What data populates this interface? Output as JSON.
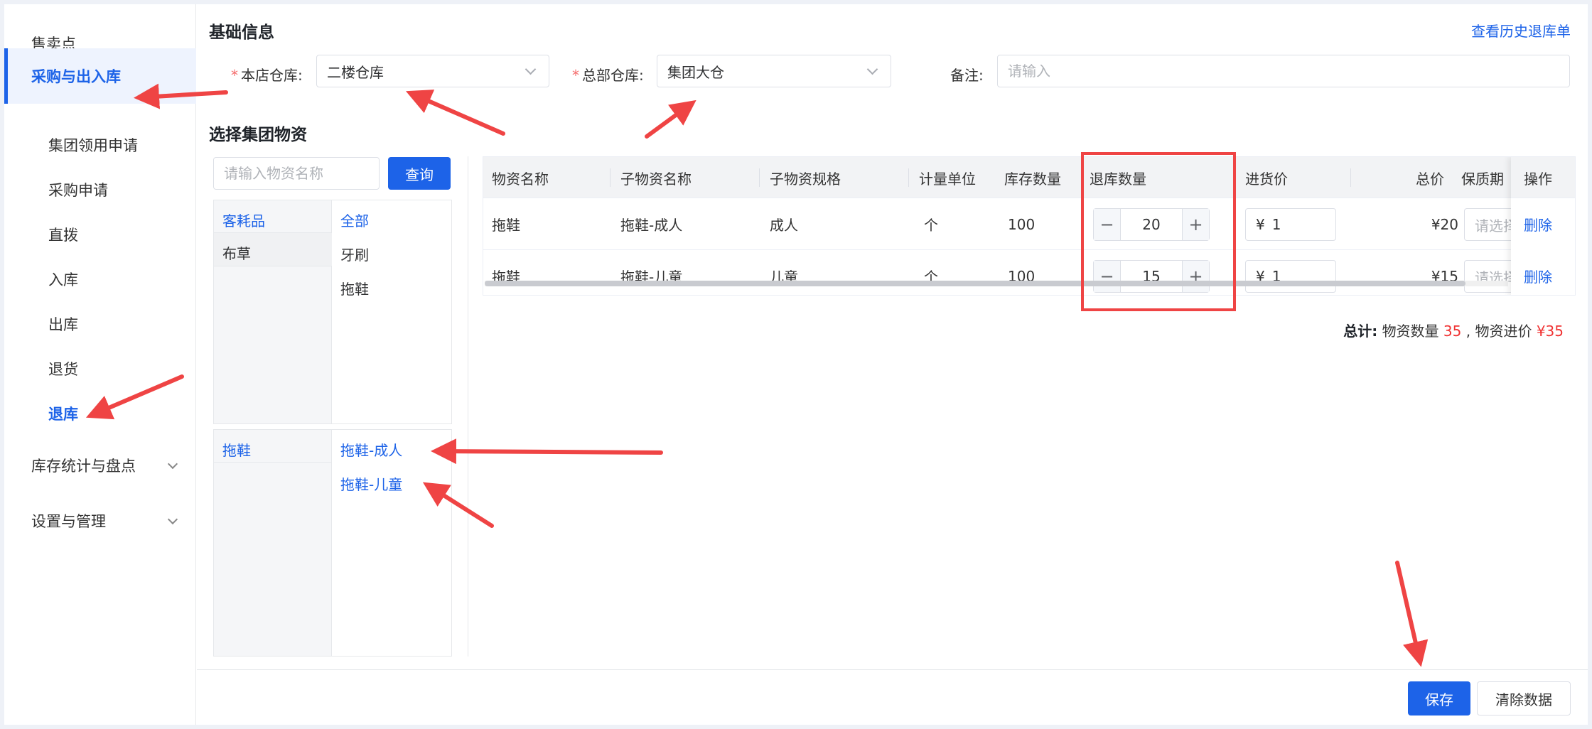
{
  "sidebar": {
    "items": [
      {
        "label": "售卖点"
      },
      {
        "label": "采购与出入库"
      },
      {
        "label": "集团领用申请"
      },
      {
        "label": "采购申请"
      },
      {
        "label": "直拨"
      },
      {
        "label": "入库"
      },
      {
        "label": "出库"
      },
      {
        "label": "退货"
      },
      {
        "label": "退库"
      },
      {
        "label": "库存统计与盘点"
      },
      {
        "label": "设置与管理"
      }
    ]
  },
  "basic": {
    "title": "基础信息",
    "history_link": "查看历史退库单",
    "store_wh_label": "本店仓库:",
    "store_wh_value": "二楼仓库",
    "hq_wh_label": "总部仓库:",
    "hq_wh_value": "集团大仓",
    "remark_label": "备注:",
    "remark_placeholder": "请输入"
  },
  "select_section": {
    "title": "选择集团物资",
    "search_placeholder": "请输入物资名称",
    "search_button": "查询",
    "categories_left": [
      "客耗品",
      "布草"
    ],
    "categories_right": [
      "全部",
      "牙刷",
      "拖鞋"
    ],
    "items_left": [
      "拖鞋"
    ],
    "items_right": [
      "拖鞋-成人",
      "拖鞋-儿童"
    ]
  },
  "table": {
    "headers": [
      "物资名称",
      "子物资名称",
      "子物资规格",
      "计量单位",
      "库存数量",
      "退库数量",
      "进货价",
      "总价",
      "保质期",
      "操作"
    ],
    "rows": [
      {
        "name": "拖鞋",
        "sub_name": "拖鞋-成人",
        "spec": "成人",
        "unit": "个",
        "stock": "100",
        "qty": "20",
        "currency": "¥",
        "price": "1",
        "total": "¥20",
        "date_placeholder": "请选择",
        "action": "删除",
        "minus": "−",
        "plus": "+"
      },
      {
        "name": "拖鞋",
        "sub_name": "拖鞋-儿童",
        "spec": "儿童",
        "unit": "个",
        "stock": "100",
        "qty": "15",
        "currency": "¥",
        "price": "1",
        "total": "¥15",
        "date_placeholder": "请选择",
        "action": "删除",
        "minus": "−",
        "plus": "+"
      }
    ]
  },
  "summary": {
    "label": "总计:",
    "count_label": "物资数量",
    "count": "35",
    "sep": ",",
    "price_label": "物资进价",
    "price": "¥35"
  },
  "footer": {
    "save": "保存",
    "clear": "清除数据"
  },
  "colors": {
    "primary": "#1d63e8",
    "annotation": "#ef4444"
  }
}
